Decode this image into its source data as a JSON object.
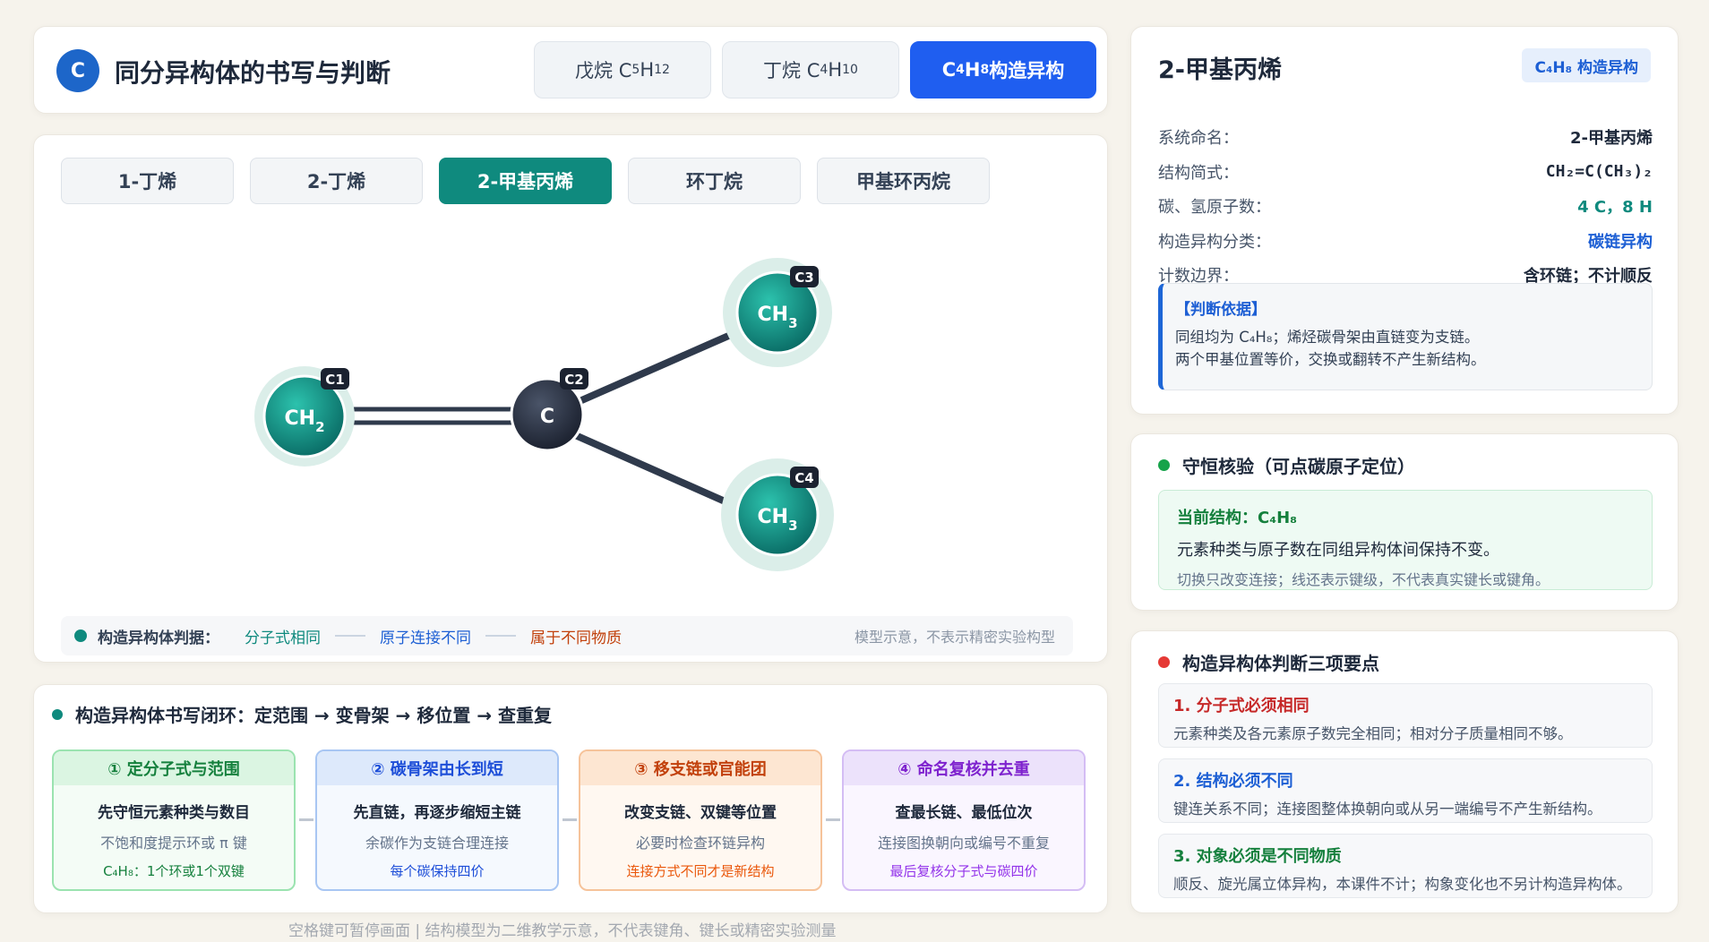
{
  "header": {
    "logo_letter": "C",
    "title": "同分异构体的书写与判断",
    "tabs": [
      {
        "pre": "戊烷 C",
        "s1": "5",
        "mid": "H",
        "s2": "12",
        "post": ""
      },
      {
        "pre": "丁烷 C",
        "s1": "4",
        "mid": "H",
        "s2": "10",
        "post": ""
      },
      {
        "pre": "C",
        "s1": "4",
        "mid": "H",
        "s2": "8",
        "post": " 构造异构"
      }
    ]
  },
  "isomer_tabs": [
    "1-丁烯",
    "2-丁烯",
    "2-甲基丙烯",
    "环丁烷",
    "甲基环丙烷"
  ],
  "molecule": {
    "atoms": [
      {
        "main": "CH",
        "sub": "2",
        "tag": "C1"
      },
      {
        "main": "C",
        "sub": "",
        "tag": "C2"
      },
      {
        "main": "CH",
        "sub": "3",
        "tag": "C3"
      },
      {
        "main": "CH",
        "sub": "3",
        "tag": "C4"
      }
    ]
  },
  "legend": {
    "label": "构造异构体判据：",
    "items": [
      "分子式相同",
      "原子连接不同",
      "属于不同物质"
    ],
    "note": "模型示意，不表示精密实验构型"
  },
  "flow": {
    "heading": "构造异构体书写闭环：定范围 → 变骨架 → 移位置 → 查重复",
    "steps": [
      {
        "title": "① 定分子式与范围",
        "l1": "先守恒元素种类与数目",
        "l2": "不饱和度提示环或 π 键",
        "l3": "C₄H₈：1个环或1个双键"
      },
      {
        "title": "② 碳骨架由长到短",
        "l1": "先直链，再逐步缩短主链",
        "l2": "余碳作为支链合理连接",
        "l3": "每个碳保持四价"
      },
      {
        "title": "③ 移支链或官能团",
        "l1": "改变支链、双键等位置",
        "l2": "必要时检查环链异构",
        "l3": "连接方式不同才是新结构"
      },
      {
        "title": "④ 命名复核并去重",
        "l1": "查最长链、最低位次",
        "l2": "连接图换朝向或编号不重复",
        "l3": "最后复核分子式与碳四价"
      }
    ]
  },
  "footer_note": "空格键可暂停画面 | 结构模型为二维教学示意，不代表键角、键长或精密实验测量",
  "info": {
    "title": "2-甲基丙烯",
    "badge": "C₄H₈ 构造异构",
    "rows": [
      {
        "k": "系统命名：",
        "v": "2-甲基丙烯"
      },
      {
        "k": "结构简式：",
        "v": "CH₂=C(CH₃)₂"
      },
      {
        "k": "碳、氢原子数：",
        "v": "4 C，8 H"
      },
      {
        "k": "构造异构分类：",
        "v": "碳链异构"
      },
      {
        "k": "计数边界：",
        "v": "含环链；不计顺反"
      }
    ],
    "basis_title": "【判断依据】",
    "basis_lines": [
      "同组均为 C₄H₈；烯烃碳骨架由直链变为支链。",
      "两个甲基位置等价，交换或翻转不产生新结构。"
    ]
  },
  "conserve": {
    "heading": "守恒核验（可点碳原子定位）",
    "l1": "当前结构：C₄H₈",
    "l2": "元素种类与原子数在同组异构体间保持不变。",
    "l3": "切换只改变连接；线还表示键级，不代表真实键长或键角。"
  },
  "points": {
    "heading": "构造异构体判断三项要点",
    "items": [
      {
        "t": "1. 分子式必须相同",
        "d": "元素种类及各元素原子数完全相同；相对分子质量相同不够。"
      },
      {
        "t": "2. 结构必须不同",
        "d": "键连关系不同；连接图整体换朝向或从另一端编号不产生新结构。"
      },
      {
        "t": "3. 对象必须是不同物质",
        "d": "顺反、旋光属立体异构，本课件不计；构象变化也不另计构造异构体。"
      }
    ]
  },
  "colors": {
    "primary_blue": "#1f5ef0",
    "teal": "#0f8a7e",
    "dark_atom": "#2c3444",
    "legend_blue": "#1d5fd4",
    "legend_red": "#c2410c",
    "red_dot": "#e53935"
  }
}
